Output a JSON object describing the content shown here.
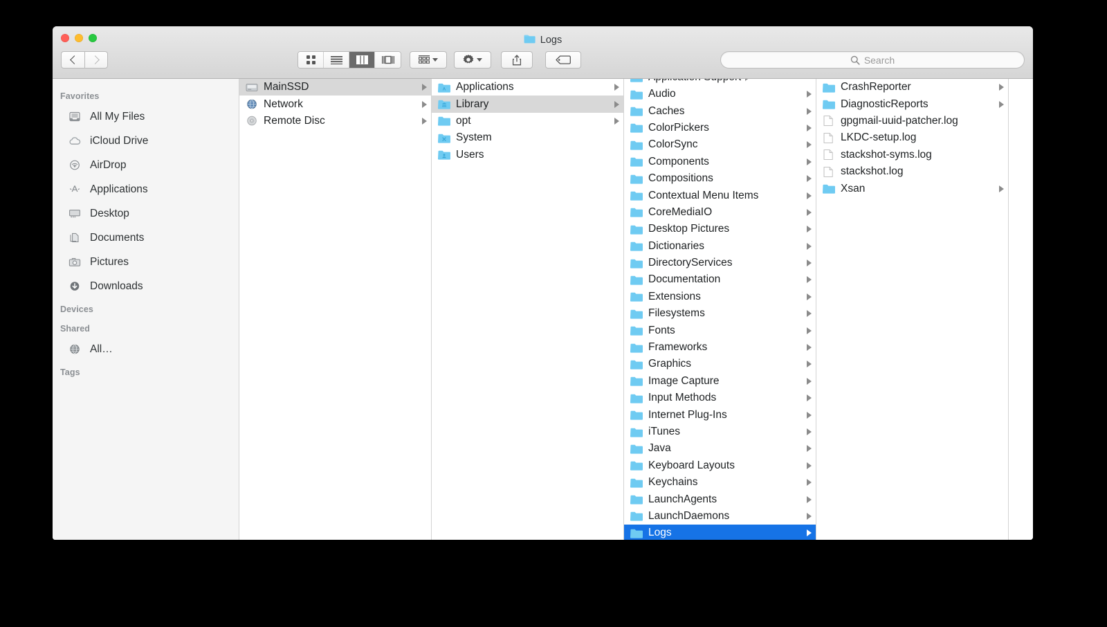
{
  "window": {
    "title": "Logs",
    "title_icon": "folder-icon",
    "traffic_lights": [
      "close",
      "minimize",
      "maximize"
    ]
  },
  "toolbar": {
    "back_label": "Back",
    "forward_label": "Forward",
    "view_buttons": [
      {
        "name": "icon-view",
        "icon": "grid-icon",
        "active": false
      },
      {
        "name": "list-view",
        "icon": "list-icon",
        "active": false
      },
      {
        "name": "column-view",
        "icon": "columns-icon",
        "active": true
      },
      {
        "name": "coverflow-view",
        "icon": "coverflow-icon",
        "active": false
      }
    ],
    "arrange_label": "Arrange",
    "action_label": "Action",
    "share_label": "Share",
    "tags_label": "Tags"
  },
  "search": {
    "placeholder": "Search",
    "value": ""
  },
  "sidebar": {
    "sections": [
      {
        "header": "Favorites",
        "items": [
          {
            "label": "All My Files",
            "icon": "all-my-files-icon"
          },
          {
            "label": "iCloud Drive",
            "icon": "cloud-icon"
          },
          {
            "label": "AirDrop",
            "icon": "airdrop-icon"
          },
          {
            "label": "Applications",
            "icon": "applications-icon"
          },
          {
            "label": "Desktop",
            "icon": "desktop-icon"
          },
          {
            "label": "Documents",
            "icon": "documents-icon"
          },
          {
            "label": "Pictures",
            "icon": "pictures-icon"
          },
          {
            "label": "Downloads",
            "icon": "downloads-icon"
          }
        ]
      },
      {
        "header": "Devices",
        "items": []
      },
      {
        "header": "Shared",
        "items": [
          {
            "label": "All…",
            "icon": "network-globe-icon"
          }
        ]
      },
      {
        "header": "Tags",
        "items": []
      }
    ]
  },
  "columns": [
    {
      "name": "column-volumes",
      "scrolled": false,
      "clipped_top": null,
      "items": [
        {
          "label": "MainSSD",
          "icon": "harddisk-icon",
          "arrow": true,
          "selected": "inactive"
        },
        {
          "label": "Network",
          "icon": "globe-icon",
          "arrow": true,
          "selected": null
        },
        {
          "label": "Remote Disc",
          "icon": "optical-disc-icon",
          "arrow": true,
          "selected": null
        }
      ]
    },
    {
      "name": "column-mainssd",
      "scrolled": false,
      "clipped_top": null,
      "items": [
        {
          "label": "Applications",
          "icon": "applications-folder-icon",
          "arrow": true,
          "selected": null
        },
        {
          "label": "Library",
          "icon": "library-folder-icon",
          "arrow": true,
          "selected": "inactive"
        },
        {
          "label": "opt",
          "icon": "folder-icon",
          "arrow": true,
          "selected": null
        },
        {
          "label": "System",
          "icon": "system-folder-icon",
          "arrow": false,
          "selected": null
        },
        {
          "label": "Users",
          "icon": "users-folder-icon",
          "arrow": false,
          "selected": null
        }
      ]
    },
    {
      "name": "column-library",
      "scrolled": true,
      "clipped_top": {
        "label": "Application Support",
        "icon": "folder-icon",
        "arrow": true
      },
      "items": [
        {
          "label": "Audio",
          "icon": "folder-icon",
          "arrow": true,
          "selected": null
        },
        {
          "label": "Caches",
          "icon": "folder-icon",
          "arrow": true,
          "selected": null
        },
        {
          "label": "ColorPickers",
          "icon": "folder-icon",
          "arrow": true,
          "selected": null
        },
        {
          "label": "ColorSync",
          "icon": "folder-icon",
          "arrow": true,
          "selected": null
        },
        {
          "label": "Components",
          "icon": "folder-icon",
          "arrow": true,
          "selected": null
        },
        {
          "label": "Compositions",
          "icon": "folder-icon",
          "arrow": true,
          "selected": null
        },
        {
          "label": "Contextual Menu Items",
          "icon": "folder-icon",
          "arrow": true,
          "selected": null
        },
        {
          "label": "CoreMediaIO",
          "icon": "folder-icon",
          "arrow": true,
          "selected": null
        },
        {
          "label": "Desktop Pictures",
          "icon": "folder-icon",
          "arrow": true,
          "selected": null
        },
        {
          "label": "Dictionaries",
          "icon": "folder-icon",
          "arrow": true,
          "selected": null
        },
        {
          "label": "DirectoryServices",
          "icon": "folder-icon",
          "arrow": true,
          "selected": null
        },
        {
          "label": "Documentation",
          "icon": "folder-icon",
          "arrow": true,
          "selected": null
        },
        {
          "label": "Extensions",
          "icon": "folder-icon",
          "arrow": true,
          "selected": null
        },
        {
          "label": "Filesystems",
          "icon": "folder-icon",
          "arrow": true,
          "selected": null
        },
        {
          "label": "Fonts",
          "icon": "folder-icon",
          "arrow": true,
          "selected": null
        },
        {
          "label": "Frameworks",
          "icon": "folder-icon",
          "arrow": true,
          "selected": null
        },
        {
          "label": "Graphics",
          "icon": "folder-icon",
          "arrow": true,
          "selected": null
        },
        {
          "label": "Image Capture",
          "icon": "folder-icon",
          "arrow": true,
          "selected": null
        },
        {
          "label": "Input Methods",
          "icon": "folder-icon",
          "arrow": true,
          "selected": null
        },
        {
          "label": "Internet Plug-Ins",
          "icon": "folder-icon",
          "arrow": true,
          "selected": null
        },
        {
          "label": "iTunes",
          "icon": "folder-icon",
          "arrow": true,
          "selected": null
        },
        {
          "label": "Java",
          "icon": "folder-icon",
          "arrow": true,
          "selected": null
        },
        {
          "label": "Keyboard Layouts",
          "icon": "folder-icon",
          "arrow": true,
          "selected": null
        },
        {
          "label": "Keychains",
          "icon": "folder-icon",
          "arrow": true,
          "selected": null
        },
        {
          "label": "LaunchAgents",
          "icon": "folder-icon",
          "arrow": true,
          "selected": null
        },
        {
          "label": "LaunchDaemons",
          "icon": "folder-icon",
          "arrow": true,
          "selected": null
        },
        {
          "label": "Logs",
          "icon": "folder-icon",
          "arrow": true,
          "selected": "active"
        }
      ]
    },
    {
      "name": "column-logs",
      "scrolled": false,
      "clipped_top": null,
      "items": [
        {
          "label": "CrashReporter",
          "icon": "folder-icon",
          "arrow": true,
          "selected": null
        },
        {
          "label": "DiagnosticReports",
          "icon": "folder-icon",
          "arrow": true,
          "selected": null
        },
        {
          "label": "gpgmail-uuid-patcher.log",
          "icon": "file-icon",
          "arrow": false,
          "selected": null
        },
        {
          "label": "LKDC-setup.log",
          "icon": "file-icon",
          "arrow": false,
          "selected": null
        },
        {
          "label": "stackshot-syms.log",
          "icon": "file-icon",
          "arrow": false,
          "selected": null
        },
        {
          "label": "stackshot.log",
          "icon": "file-icon",
          "arrow": false,
          "selected": null
        },
        {
          "label": "Xsan",
          "icon": "folder-icon",
          "arrow": true,
          "selected": null
        }
      ]
    }
  ],
  "colors": {
    "selection_active": "#1673e6",
    "selection_inactive": "#d8d8d8",
    "folder_blue": "#6fcbf2",
    "sidebar_bg": "#f5f5f5",
    "titlebar_top": "#e9e9e9",
    "titlebar_bottom": "#d5d5d5"
  }
}
